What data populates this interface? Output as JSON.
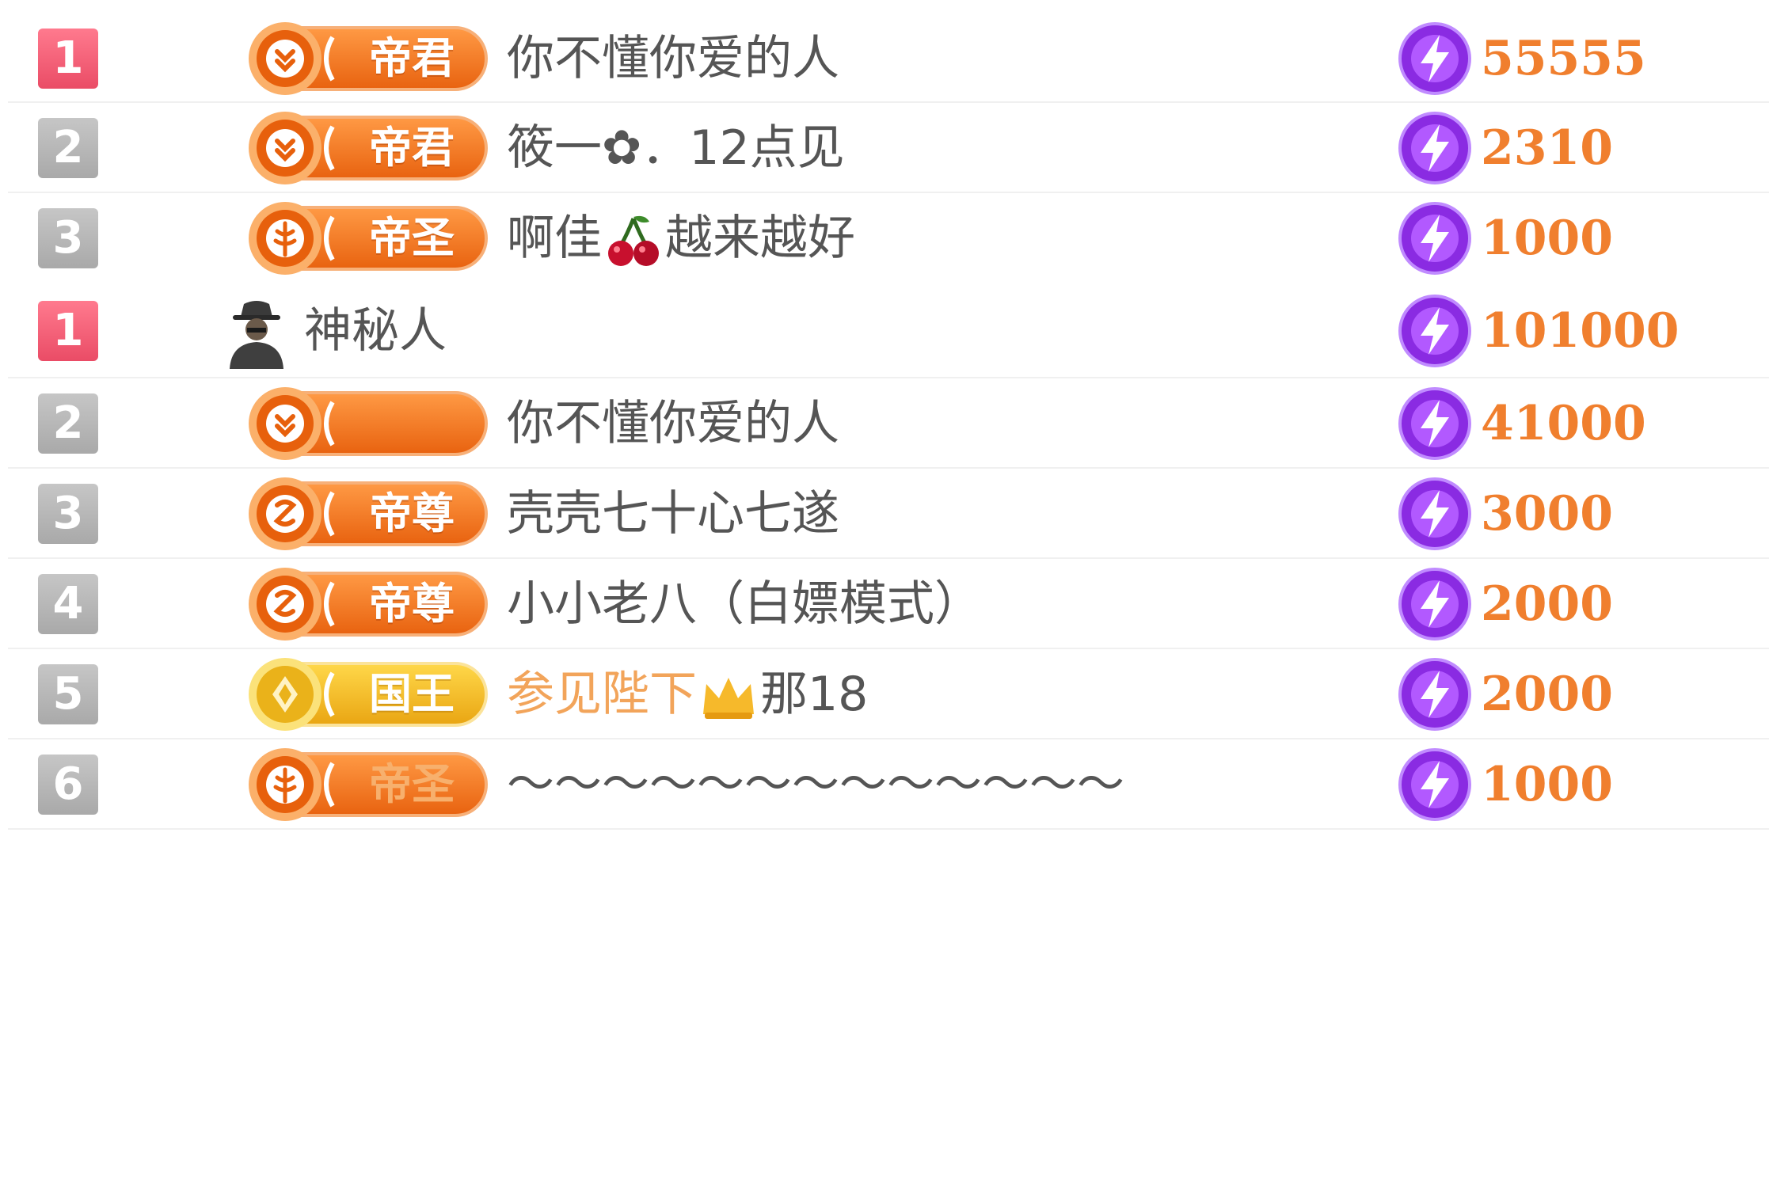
{
  "colors": {
    "rank_top": "#ea4c66",
    "rank_other": "#a9a9a9",
    "badge_orange": "#f07a22",
    "badge_gold": "#f5c22a",
    "value_orange": "#f07f2e",
    "gift_purple": "#8a2be2",
    "name_gray": "#555555",
    "name_highlight": "#f2a45a"
  },
  "lists": [
    {
      "rows": [
        {
          "rank": "1",
          "badge": {
            "label": "帝君",
            "icon": "emperor-medal-icon"
          },
          "name": "你不懂你爱的人",
          "gift_icon": "lightning-gift-icon",
          "value": "55555"
        },
        {
          "rank": "2",
          "badge": {
            "label": "帝君",
            "icon": "emperor-medal-icon"
          },
          "name": "筱一✿．12点见",
          "gift_icon": "lightning-gift-icon",
          "value": "2310"
        },
        {
          "rank": "3",
          "badge": {
            "label": "帝圣",
            "icon": "sage-medal-icon"
          },
          "name_before": "啊佳",
          "name_emoji": "cherry-icon",
          "name_after": "越来越好",
          "gift_icon": "lightning-gift-icon",
          "value": "1000"
        }
      ]
    },
    {
      "rows": [
        {
          "rank": "1",
          "avatar_icon": "mystery-person-icon",
          "name": "神秘人",
          "gift_icon": "lightning-gift-icon",
          "value": "101000"
        },
        {
          "rank": "2",
          "badge": {
            "label": "",
            "icon": "emperor-medal-icon"
          },
          "name": "你不懂你爱的人",
          "gift_icon": "lightning-gift-icon",
          "value": "41000"
        },
        {
          "rank": "3",
          "badge": {
            "label": "帝尊",
            "icon": "supreme-medal-icon"
          },
          "name": "壳壳七十心七遂",
          "gift_icon": "lightning-gift-icon",
          "value": "3000"
        },
        {
          "rank": "4",
          "badge": {
            "label": "帝尊",
            "icon": "supreme-medal-icon"
          },
          "name": "小小老八（白嫖模式）",
          "gift_icon": "lightning-gift-icon",
          "value": "2000"
        },
        {
          "rank": "5",
          "badge": {
            "label": "国王",
            "icon": "king-medal-icon"
          },
          "name_highlight": "参见陛下",
          "name_emoji": "crown-icon",
          "name_after": "那18",
          "gift_icon": "lightning-gift-icon",
          "value": "2000"
        },
        {
          "rank": "6",
          "badge": {
            "label": "帝圣",
            "icon": "sage-medal-icon"
          },
          "name": "～～～～～～～～～～～～～",
          "gift_icon": "lightning-gift-icon",
          "value": "1000"
        }
      ]
    }
  ]
}
